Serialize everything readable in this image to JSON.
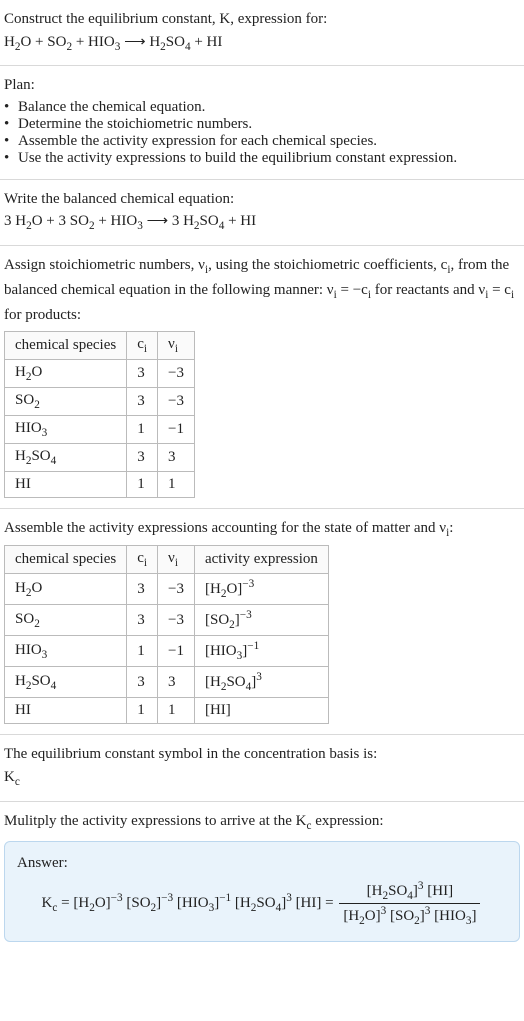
{
  "intro": {
    "prompt": "Construct the equilibrium constant, K, expression for:",
    "equation_html": "H<sub>2</sub>O + SO<sub>2</sub> + HIO<sub>3</sub> ⟶ H<sub>2</sub>SO<sub>4</sub> + HI"
  },
  "plan": {
    "heading": "Plan:",
    "items": [
      "Balance the chemical equation.",
      "Determine the stoichiometric numbers.",
      "Assemble the activity expression for each chemical species.",
      "Use the activity expressions to build the equilibrium constant expression."
    ]
  },
  "balanced": {
    "heading": "Write the balanced chemical equation:",
    "equation_html": "3 H<sub>2</sub>O + 3 SO<sub>2</sub> + HIO<sub>3</sub> ⟶ 3 H<sub>2</sub>SO<sub>4</sub> + HI"
  },
  "stoich": {
    "intro_html": "Assign stoichiometric numbers, ν<sub>i</sub>, using the stoichiometric coefficients, c<sub>i</sub>, from the balanced chemical equation in the following manner: ν<sub>i</sub> = −c<sub>i</sub> for reactants and ν<sub>i</sub> = c<sub>i</sub> for products:",
    "headers": {
      "species": "chemical species",
      "ci_html": "c<sub>i</sub>",
      "vi_html": "ν<sub>i</sub>"
    },
    "rows": [
      {
        "species_html": "H<sub>2</sub>O",
        "ci": "3",
        "vi": "−3"
      },
      {
        "species_html": "SO<sub>2</sub>",
        "ci": "3",
        "vi": "−3"
      },
      {
        "species_html": "HIO<sub>3</sub>",
        "ci": "1",
        "vi": "−1"
      },
      {
        "species_html": "H<sub>2</sub>SO<sub>4</sub>",
        "ci": "3",
        "vi": "3"
      },
      {
        "species_html": "HI",
        "ci": "1",
        "vi": "1"
      }
    ]
  },
  "activity": {
    "intro_html": "Assemble the activity expressions accounting for the state of matter and ν<sub>i</sub>:",
    "headers": {
      "species": "chemical species",
      "ci_html": "c<sub>i</sub>",
      "vi_html": "ν<sub>i</sub>",
      "act": "activity expression"
    },
    "rows": [
      {
        "species_html": "H<sub>2</sub>O",
        "ci": "3",
        "vi": "−3",
        "act_html": "[H<sub>2</sub>O]<sup>−3</sup>"
      },
      {
        "species_html": "SO<sub>2</sub>",
        "ci": "3",
        "vi": "−3",
        "act_html": "[SO<sub>2</sub>]<sup>−3</sup>"
      },
      {
        "species_html": "HIO<sub>3</sub>",
        "ci": "1",
        "vi": "−1",
        "act_html": "[HIO<sub>3</sub>]<sup>−1</sup>"
      },
      {
        "species_html": "H<sub>2</sub>SO<sub>4</sub>",
        "ci": "3",
        "vi": "3",
        "act_html": "[H<sub>2</sub>SO<sub>4</sub>]<sup>3</sup>"
      },
      {
        "species_html": "HI",
        "ci": "1",
        "vi": "1",
        "act_html": "[HI]"
      }
    ]
  },
  "symbol": {
    "line1": "The equilibrium constant symbol in the concentration basis is:",
    "line2_html": "K<sub>c</sub>"
  },
  "multiply": {
    "intro_html": "Mulitply the activity expressions to arrive at the K<sub>c</sub> expression:"
  },
  "answer": {
    "label": "Answer:",
    "lhs_html": "K<sub>c</sub> = [H<sub>2</sub>O]<sup>−3</sup> [SO<sub>2</sub>]<sup>−3</sup> [HIO<sub>3</sub>]<sup>−1</sup> [H<sub>2</sub>SO<sub>4</sub>]<sup>3</sup> [HI] = ",
    "num_html": "[H<sub>2</sub>SO<sub>4</sub>]<sup>3</sup> [HI]",
    "den_html": "[H<sub>2</sub>O]<sup>3</sup> [SO<sub>2</sub>]<sup>3</sup> [HIO<sub>3</sub>]"
  }
}
